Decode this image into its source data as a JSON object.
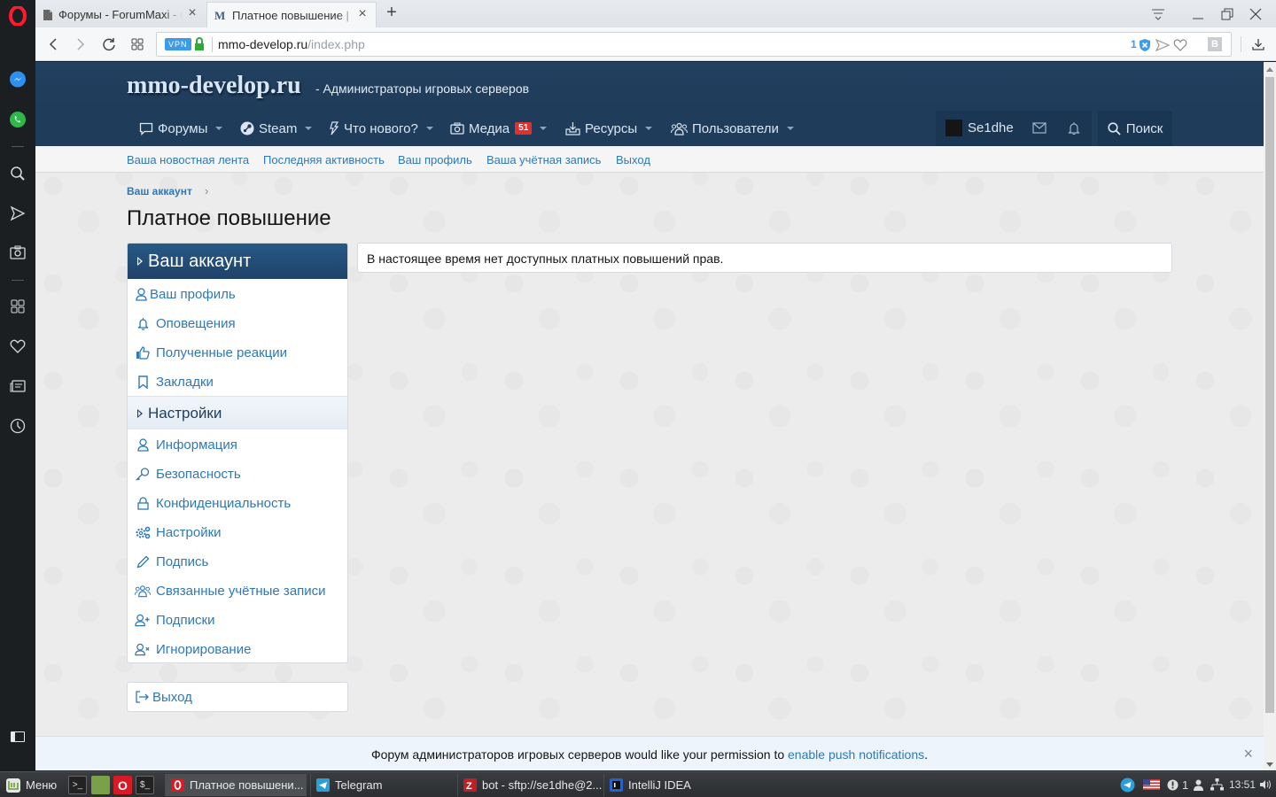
{
  "browser": {
    "tabs": [
      {
        "title": "Форумы - ForumMaxi - C",
        "icon": "document-icon",
        "active": false
      },
      {
        "title": "Платное повышение | ",
        "icon": "site-favicon",
        "active": true
      }
    ],
    "new_tab_label": "+",
    "address": {
      "vpn_label": "VPN",
      "domain": "mmo-develop.ru",
      "path": "/index.php",
      "adblock_count": "1"
    },
    "extension_label": "B"
  },
  "opera_sidebar": {
    "items": [
      "opera-logo",
      "messenger-icon",
      "whatsapp-icon",
      "search-icon",
      "send-icon",
      "camera-icon",
      "speed-dial-icon",
      "heart-icon",
      "news-icon",
      "history-icon",
      "sidebar-toggle-icon"
    ]
  },
  "site": {
    "logo": "mmo-develop.ru",
    "tagline": "- Администраторы игровых серверов",
    "nav": [
      {
        "label": "Форумы",
        "icon": "comment-icon",
        "has_menu": true
      },
      {
        "label": "Steam",
        "icon": "steam-icon",
        "has_menu": true
      },
      {
        "label": "Что нового?",
        "icon": "bolt-icon",
        "has_menu": true
      },
      {
        "label": "Медиа",
        "icon": "camera-icon",
        "badge": "51",
        "has_menu": true
      },
      {
        "label": "Ресурсы",
        "icon": "download-box-icon",
        "has_menu": true
      },
      {
        "label": "Пользователи",
        "icon": "users-icon",
        "has_menu": true
      }
    ],
    "user": {
      "name": "Se1dhe"
    },
    "search_label": "Поиск",
    "sub_nav": [
      "Ваша новостная лента",
      "Последняя активность",
      "Ваш профиль",
      "Ваша учётная запись",
      "Выход"
    ]
  },
  "content": {
    "breadcrumb": "Ваш аккаунт",
    "title": "Платное повышение",
    "side_nav": {
      "account_header": "Ваш аккаунт",
      "account_items": [
        {
          "label": "Ваш профиль",
          "icon": "user-icon"
        },
        {
          "label": "Оповещения",
          "icon": "bell-icon"
        },
        {
          "label": "Полученные реакции",
          "icon": "thumbs-up-icon"
        },
        {
          "label": "Закладки",
          "icon": "bookmark-icon"
        }
      ],
      "settings_header": "Настройки",
      "settings_items": [
        {
          "label": "Информация",
          "icon": "user-icon"
        },
        {
          "label": "Безопасность",
          "icon": "key-icon"
        },
        {
          "label": "Конфиденциальность",
          "icon": "lock-icon"
        },
        {
          "label": "Настройки",
          "icon": "cogs-icon"
        },
        {
          "label": "Подпись",
          "icon": "pencil-icon"
        },
        {
          "label": "Связанные учётные записи",
          "icon": "users-icon"
        },
        {
          "label": "Подписки",
          "icon": "user-plus-icon"
        },
        {
          "label": "Игнорирование",
          "icon": "user-times-icon"
        }
      ],
      "logout": "Выход"
    },
    "notice": "В настоящее время нет доступных платных повышений прав."
  },
  "push_notice": {
    "text": "Форум администраторов игровых серверов would like your permission to ",
    "link": "enable push notifications",
    "suffix": ".",
    "close": "×"
  },
  "taskbar": {
    "menu_label": "Меню",
    "windows": [
      {
        "title": "Платное повышени...",
        "icon": "opera-icon",
        "active": true
      },
      {
        "title": "Telegram",
        "icon": "telegram-icon",
        "active": false
      },
      {
        "title": "bot - sftp://se1dhe@2...",
        "icon": "filezilla-icon",
        "active": false
      },
      {
        "title": "IntelliJ IDEA",
        "icon": "intellij-icon",
        "active": false
      }
    ],
    "tray": {
      "notification_count": "1",
      "clock": "13:51"
    }
  },
  "colors": {
    "header_bg": "#223f5e",
    "nav_bg": "#1f3c5b",
    "link": "#2e78b8",
    "badge": "#e03030",
    "vpn": "#3d9be9"
  }
}
